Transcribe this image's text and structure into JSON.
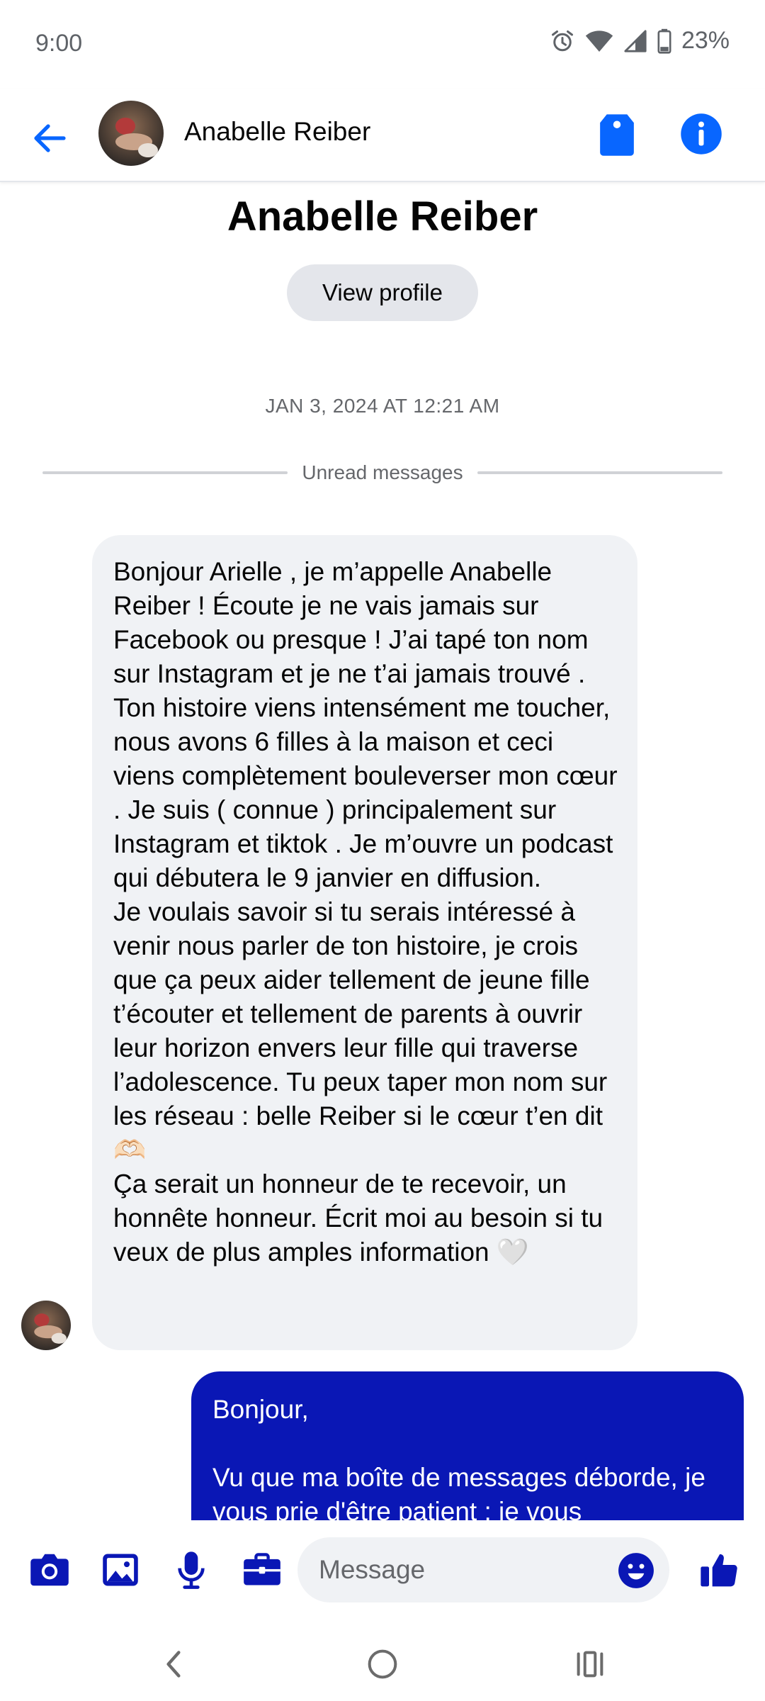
{
  "status_bar": {
    "time": "9:00",
    "battery": "23%",
    "icons": [
      "alarm-icon",
      "wifi-icon",
      "signal-icon",
      "battery-icon"
    ]
  },
  "header": {
    "contact_name": "Anabelle Reiber",
    "icons": [
      "back-arrow-icon",
      "tag-icon",
      "info-icon"
    ],
    "accent_color": "#0866ff"
  },
  "profile": {
    "name": "Anabelle Reiber",
    "view_profile_label": "View profile"
  },
  "conversation": {
    "timestamp": "JAN 3, 2024 AT 12:21 AM",
    "unread_label": "Unread messages",
    "messages": [
      {
        "direction": "incoming",
        "text": "Bonjour Arielle , je m’appelle Anabelle Reiber ! Écoute je ne vais jamais sur Facebook ou presque ! J’ai tapé ton nom sur Instagram et je ne t’ai jamais trouvé . Ton histoire  viens intensément me toucher, nous avons 6 filles à la maison et ceci viens complètement bouleverser mon cœur . Je suis ( connue ) principalement sur Instagram et tiktok . Je m’ouvre un podcast qui débutera le 9 janvier en diffusion.\nJe voulais savoir si tu serais intéressé à venir nous parler de ton histoire, je crois que ça peux aider tellement de jeune fille t’écouter et tellement de parents à ouvrir leur horizon envers leur fille qui traverse l’adolescence. Tu peux taper mon nom sur les réseau : belle Reiber si le cœur t’en dit 🫶🏻\nÇa serait un honneur de te recevoir, un honnête honneur. Écrit moi au besoin si tu veux de plus amples information 🤍"
      },
      {
        "direction": "outgoing",
        "text": "Bonjour,\n\nVu que ma boîte de messages déborde, je vous prie d'être patient ; je vous"
      }
    ],
    "outgoing_color": "#0a17b5"
  },
  "composer": {
    "placeholder": "Message",
    "icons": [
      "camera-icon",
      "gallery-icon",
      "microphone-icon",
      "briefcase-icon",
      "emoji-icon",
      "thumbs-up-icon"
    ],
    "icon_color": "#0a17b5"
  },
  "nav_bar": {
    "icons": [
      "back-nav-icon",
      "home-nav-icon",
      "recents-nav-icon"
    ]
  }
}
